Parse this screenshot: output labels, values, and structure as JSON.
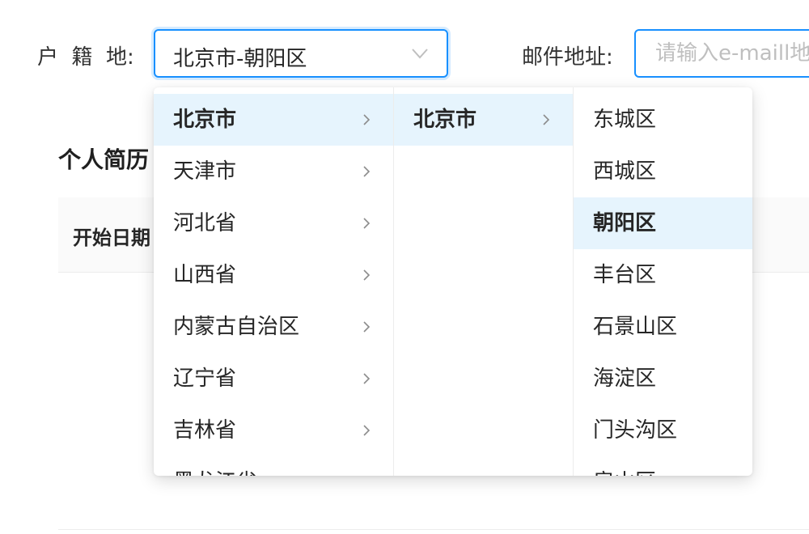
{
  "form": {
    "huji_label": "户  籍  地:",
    "huji_value": "北京市-朝阳区",
    "email_label": "邮件地址:",
    "email_placeholder": "请输入e-maill地址"
  },
  "resume": {
    "title": "个人简历",
    "col_start_date": "开始日期"
  },
  "cascader": {
    "provinces": [
      {
        "label": "北京市",
        "active": true
      },
      {
        "label": "天津市"
      },
      {
        "label": "河北省"
      },
      {
        "label": "山西省"
      },
      {
        "label": "内蒙古自治区"
      },
      {
        "label": "辽宁省"
      },
      {
        "label": "吉林省"
      },
      {
        "label": "黑龙江省"
      }
    ],
    "cities": [
      {
        "label": "北京市",
        "active": true
      }
    ],
    "districts": [
      {
        "label": "东城区"
      },
      {
        "label": "西城区"
      },
      {
        "label": "朝阳区",
        "active": true
      },
      {
        "label": "丰台区"
      },
      {
        "label": "石景山区"
      },
      {
        "label": "海淀区"
      },
      {
        "label": "门头沟区"
      },
      {
        "label": "房山区"
      }
    ]
  },
  "colors": {
    "accent": "#1890ff",
    "active_bg": "#e6f4fd"
  },
  "icons": {
    "select_arrow": "chevron-down-icon",
    "expand": "chevron-right-icon"
  }
}
